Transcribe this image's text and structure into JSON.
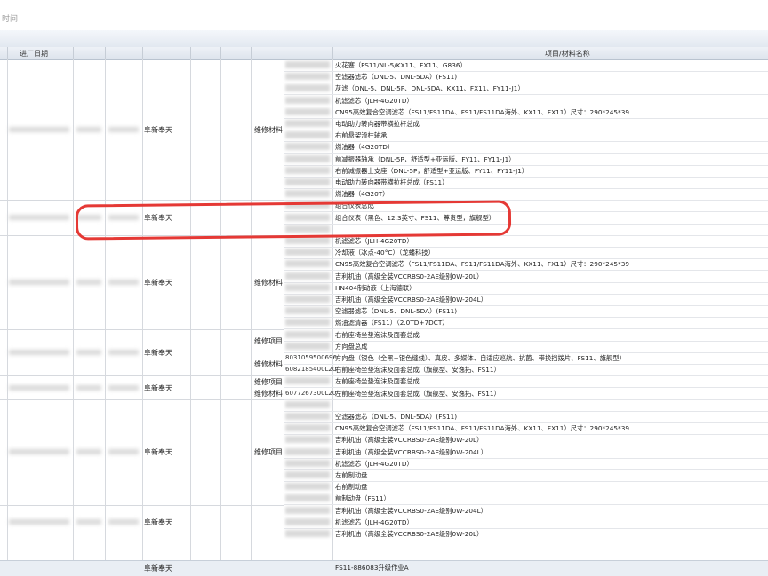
{
  "window_title": "时间",
  "headers": {
    "date": "进厂日期",
    "items": "项目/材料名称"
  },
  "groups": [
    {
      "vendor": "阜新奉天",
      "kinds": [
        {
          "label": "维修材料"
        }
      ],
      "rows": [
        {
          "name": "火花塞（FS11/NL-5/KX11、FX11、G836）"
        },
        {
          "name": "空滤器滤芯（DNL-5、DNL-5DA）(FS11)"
        },
        {
          "name": "灰滤（DNL-5、DNL-5P、DNL-5DA、KX11、FX11、FY11-J1）"
        },
        {
          "name": "机滤滤芯（JLH-4G20TD）"
        },
        {
          "name": "CN95高效复合空调滤芯（FS11/FS11DA、FS11/FS11DA海外、KX11、FX11）尺寸：290*245*39"
        },
        {
          "name": "电动助力转向器带横拉杆总成"
        },
        {
          "name": "右前悬架滑柱轴承"
        },
        {
          "name": "燃油器（4G20TD）"
        },
        {
          "name": "前减振器轴承（DNL-5P，舒适型+亚运版、FY11、FY11-J1）"
        },
        {
          "name": "右前减振器上支座（DNL-5P，舒适型+亚运版、FY11、FY11-J1）"
        },
        {
          "name": "电动助力转向器带横拉杆总成（FS11）"
        },
        {
          "name": "燃油器（4G20T）"
        }
      ]
    },
    {
      "vendor": "阜新奉天",
      "kinds": [],
      "rows": [
        {
          "name": "组合仪表总成"
        },
        {
          "name": "组合仪表（黑色、12.3英寸、FS11、尊贵型，旗舰型）"
        },
        {
          "name": ""
        }
      ]
    },
    {
      "vendor": "阜新奉天",
      "kinds": [
        {
          "label": "维修材料"
        }
      ],
      "rows": [
        {
          "name": "机滤滤芯（JLH-4G20TD）"
        },
        {
          "name": "冷却液（冰点-40°C）（龙蟠科技）"
        },
        {
          "name": "CN95高效复合空调滤芯（FS11/FS11DA、FS11/FS11DA海外、KX11、FX11）尺寸：290*245*39"
        },
        {
          "name": "吉利机油（高级全装VCCRBS0-2AE级别0W-20L）"
        },
        {
          "name": "HN404制动液（上海德联）"
        },
        {
          "name": "吉利机油（高级全装VCCRBS0-2AE级别0W-204L）"
        },
        {
          "name": "空滤器滤芯（DNL-5、DNL-5DA）(FS11)"
        },
        {
          "name": "燃油滤清器（FS11）（2.0TD+7DCT）"
        }
      ]
    },
    {
      "vendor": "阜新奉天",
      "kinds": [
        {
          "label": "维修项目"
        },
        {
          "label": "维修材料"
        }
      ],
      "rows": [
        {
          "name": "右前座椅坐垫泡沫及面套总成"
        },
        {
          "name": "方向盘总成"
        },
        {
          "code": "8031059500696",
          "name": "方向盘（银色（全黑+银色缝线）、真皮、多媒体、自适应巡航、抗菌、带换挡拨片、FS11、旗舰型）"
        },
        {
          "code": "6082185400L20",
          "name": "右前座椅坐垫泡沫及面套总成（旗舰型、安逸拓、FS11）"
        }
      ]
    },
    {
      "vendor": "阜新奉天",
      "kinds": [
        {
          "label": "维修项目"
        },
        {
          "label": "维修材料"
        }
      ],
      "rows": [
        {
          "name": "左前座椅坐垫泡沫及面套总成"
        },
        {
          "code": "6077267300L20",
          "name": "左前座椅坐垫泡沫及面套总成（旗舰型、安逸拓、FS11）"
        }
      ]
    },
    {
      "vendor": "阜新奉天",
      "kinds": [
        {
          "label": "维修项目"
        }
      ],
      "rows": [
        {
          "name": ""
        },
        {
          "name": "空滤器滤芯（DNL-5、DNL-5DA）(FS11)"
        },
        {
          "name": "CN95高效复合空调滤芯（FS11/FS11DA、FS11/FS11DA海外、KX11、FX11）尺寸：290*245*39"
        },
        {
          "name": "吉利机油（高级全装VCCRBS0-2AE级别0W-20L）"
        },
        {
          "name": "吉利机油（高级全装VCCRBS0-2AE级别0W-204L）"
        },
        {
          "name": "机滤滤芯（JLH-4G20TD）"
        },
        {
          "name": "左前制动盘"
        },
        {
          "name": "右前制动盘"
        },
        {
          "name": "前制动盘（FS11）"
        }
      ]
    },
    {
      "vendor": "阜新奉天",
      "kinds": [],
      "rows": [
        {
          "name": "吉利机油（高级全装VCCRBS0-2AE级别0W-204L）"
        },
        {
          "name": "机滤滤芯（JLH-4G20TD）"
        },
        {
          "name": "吉利机油（高级全装VCCRBS0-2AE级别0W-20L）"
        }
      ]
    }
  ],
  "footer": {
    "vendor": "阜新奉天",
    "name": "FS11-886083升级作业A"
  }
}
